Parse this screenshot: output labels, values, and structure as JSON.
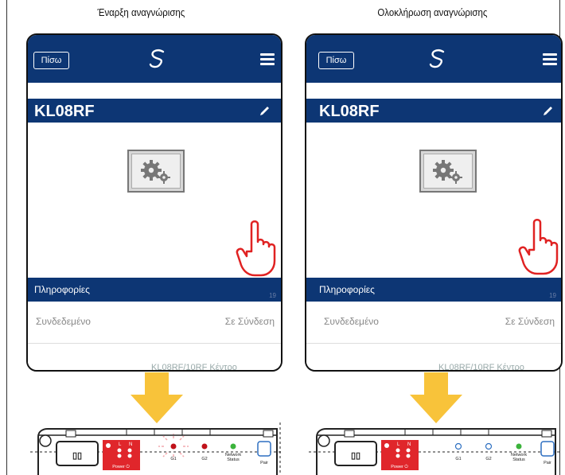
{
  "captions": {
    "left": "Έναρξη αναγνώρισης",
    "right": "Ολοκλήρωση αναγνώρισης"
  },
  "app": {
    "back_label": "Πίσω",
    "device_name": "KL08RF",
    "info_title": "Πληροφορίες",
    "info_number": "19",
    "status_label": "Συνδεδεμένο",
    "status_value": "Σε Σύνδεση",
    "truncated_text_left": "KL08RF/10RF Κέντρο",
    "truncated_text_right": "KL08RF/10RF Κέντρο",
    "icons": [
      "logo-icon",
      "menu-icon",
      "pencil-icon",
      "gear-icon",
      "eye-icon",
      "hand-pointer-icon"
    ]
  },
  "panel": {
    "power_label": "Power ⏻",
    "l_label": "L",
    "n_label": "N",
    "g1_label": "G1",
    "g2_label": "G2",
    "network_label": "Network",
    "status_label": "Status",
    "pair_label": "Pair",
    "button_label": "▯▯"
  },
  "colors": {
    "navy": "#0d3674",
    "arrow": "#f8c33a",
    "panel_red": "#e0262b",
    "led_green": "#3bb33b",
    "led_red": "#c0121a",
    "led_blue": "#2d6fc1"
  }
}
